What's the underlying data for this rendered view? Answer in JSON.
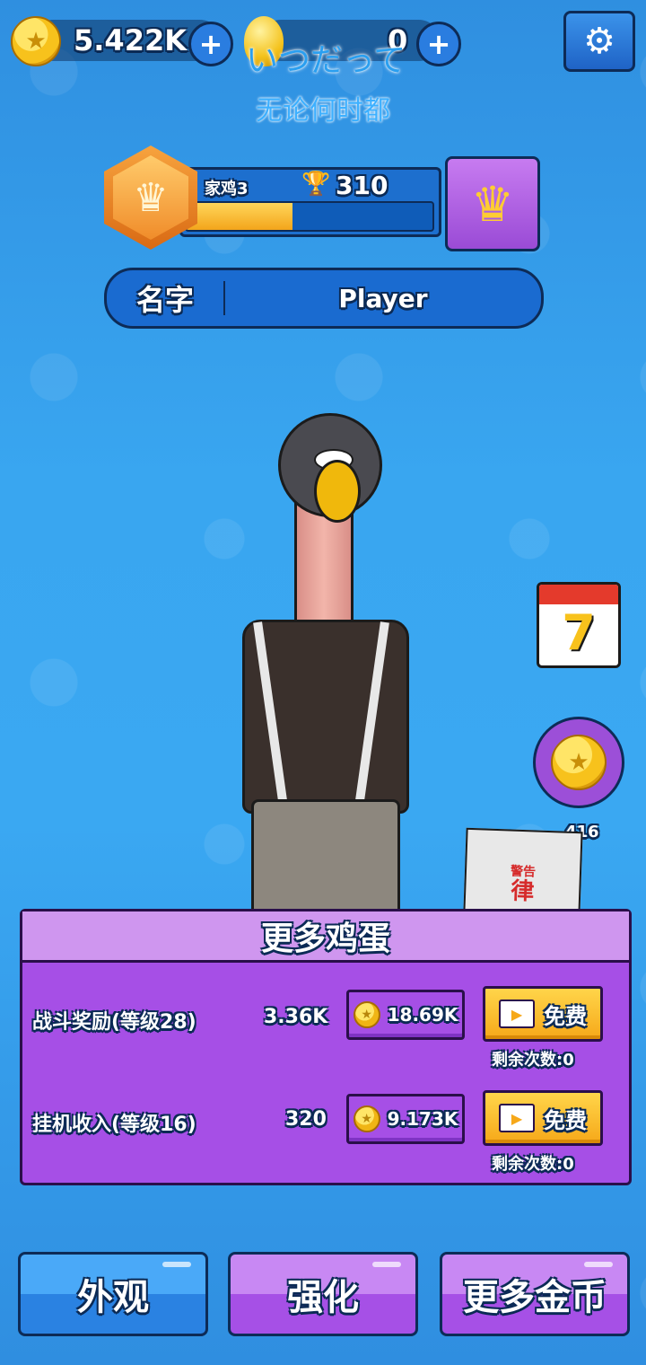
{
  "topbar": {
    "coins": "5.422K",
    "overlay_title": "いつだって",
    "gems": "0",
    "subtitle": "无论何时都"
  },
  "rank": {
    "name": "家鸡3",
    "trophies": "310",
    "progress": 0.43
  },
  "profile": {
    "name_label": "名字",
    "player_name": "Player"
  },
  "side": {
    "calendar_day": "7",
    "coin_reward_count": "416"
  },
  "panel": {
    "title": "更多鸡蛋",
    "rows": [
      {
        "label": "战斗奖励(等级28)",
        "value": "3.36K",
        "price": "18.69K",
        "free_label": "免费",
        "remaining": "剩余次数:0"
      },
      {
        "label": "挂机收入(等级16)",
        "value": "320",
        "price": "9.173K",
        "free_label": "免费",
        "remaining": "剩余次数:0"
      }
    ]
  },
  "nav": {
    "appearance": "外观",
    "upgrade": "强化",
    "more_coins": "更多金币"
  },
  "newspaper": {
    "headline": "警告",
    "big_char": "律"
  }
}
